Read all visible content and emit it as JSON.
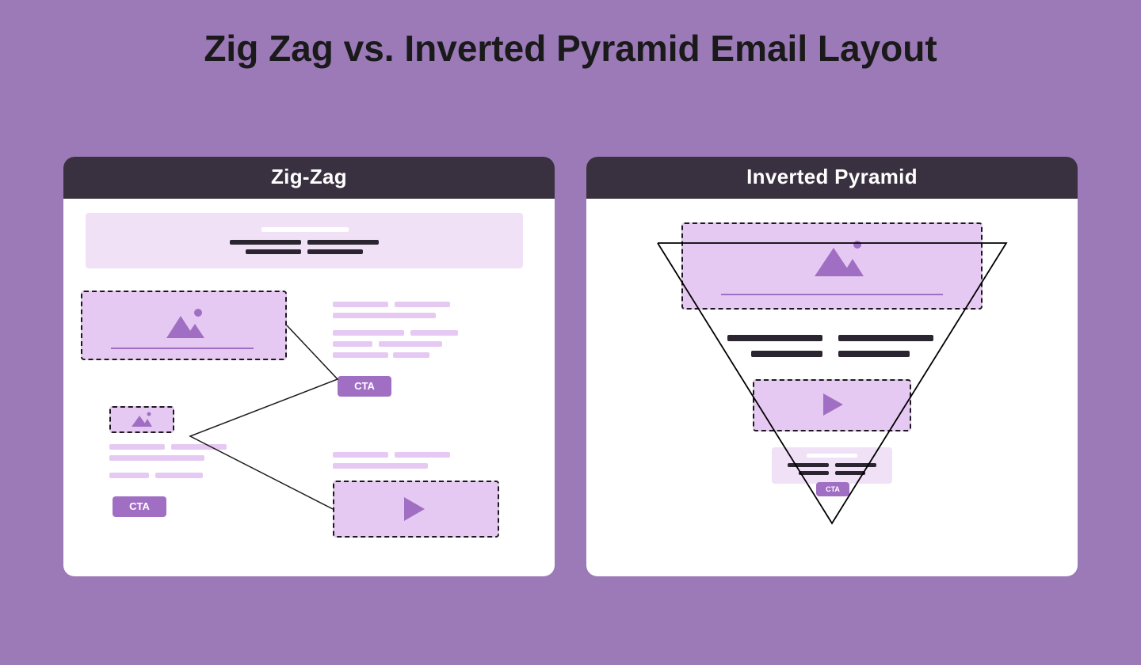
{
  "title": "Zig Zag vs. Inverted Pyramid Email Layout",
  "panels": {
    "left": {
      "header": "Zig-Zag",
      "cta1": "CTA",
      "cta2": "CTA"
    },
    "right": {
      "header": "Inverted Pyramid",
      "cta": "CTA"
    }
  },
  "colors": {
    "bg": "#9c7ab8",
    "headerBar": "#3a3140",
    "lightFill": "#f0e1f7",
    "midFill": "#e6c9f2",
    "ctaFill": "#a06fc4",
    "darkLine": "#2a2530"
  }
}
